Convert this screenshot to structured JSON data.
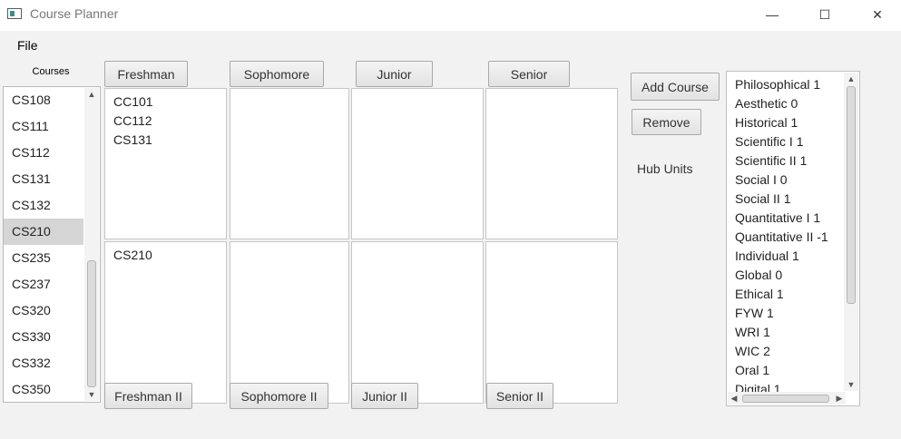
{
  "window": {
    "title": "Course Planner",
    "minimize_glyph": "—",
    "maximize_glyph": "☐",
    "close_glyph": "✕"
  },
  "menu": {
    "file": "File"
  },
  "courses": {
    "header": "Courses",
    "items": [
      "CS108",
      "CS111",
      "CS112",
      "CS131",
      "CS132",
      "CS210",
      "CS235",
      "CS237",
      "CS320",
      "CS330",
      "CS332",
      "CS350"
    ],
    "selected": "CS210"
  },
  "years": {
    "fall": [
      "Freshman",
      "Sophomore",
      "Junior",
      "Senior"
    ],
    "spring": [
      "Freshman II",
      "Sophomore II",
      "Junior II",
      "Senior II"
    ]
  },
  "semesters": {
    "freshman_fall": [
      "CC101",
      "CC112",
      "CS131"
    ],
    "freshman_spring": [
      "CS210"
    ],
    "sophomore_fall": [],
    "sophomore_spring": [],
    "junior_fall": [],
    "junior_spring": [],
    "senior_fall": [],
    "senior_spring": []
  },
  "actions": {
    "add_course": "Add Course",
    "remove": "Remove"
  },
  "hub": {
    "label": "Hub Units",
    "items": [
      "Philosophical 1",
      "Aesthetic 0",
      "Historical 1",
      "Scientific I 1",
      "Scientific II 1",
      "Social I 0",
      "Social II 1",
      "Quantitative I 1",
      "Quantitative II -1",
      "Individual 1",
      "Global 0",
      "Ethical 1",
      "FYW 1",
      "WRI 1",
      "WIC 2",
      "Oral 1",
      "Digital 1"
    ]
  },
  "icons": {
    "scroll_up": "chevron-up-icon",
    "scroll_down": "chevron-down-icon",
    "scroll_left": "chevron-left-icon",
    "scroll_right": "chevron-right-icon"
  }
}
